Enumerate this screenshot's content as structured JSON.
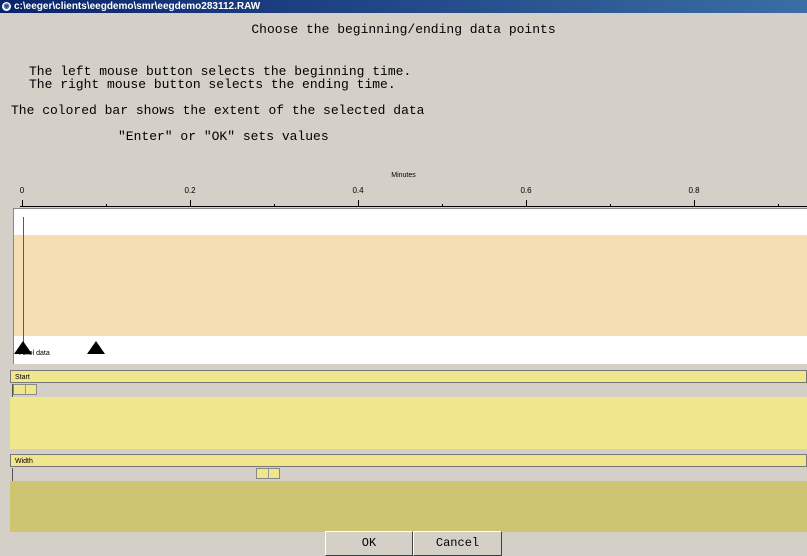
{
  "window": {
    "title": "c:\\eeger\\clients\\eegdemo\\smr\\eegdemo283112.RAW"
  },
  "instructions": {
    "heading": "Choose the beginning/ending data points",
    "line1": "The left mouse button selects the beginning time.",
    "line2": "The right mouse button selects the ending time.",
    "line3": "The colored bar shows the extent of the selected data",
    "line4": "\"Enter\" or \"OK\" sets values"
  },
  "axis": {
    "title": "Minutes",
    "tick_labels": [
      "0",
      "0.2",
      "0.4",
      "0.6",
      "0.8"
    ]
  },
  "plot": {
    "label": "Pixel data",
    "colors": {
      "band": "#f5deb3",
      "cursor": "#e02020",
      "marker": "#000000"
    }
  },
  "start": {
    "label": "Start"
  },
  "width": {
    "label": "Width"
  },
  "buttons": {
    "ok": "OK",
    "cancel": "Cancel"
  },
  "colors": {
    "start_body": "#f0e68c",
    "width_body": "#cdc572",
    "header": "#f0e68c"
  }
}
